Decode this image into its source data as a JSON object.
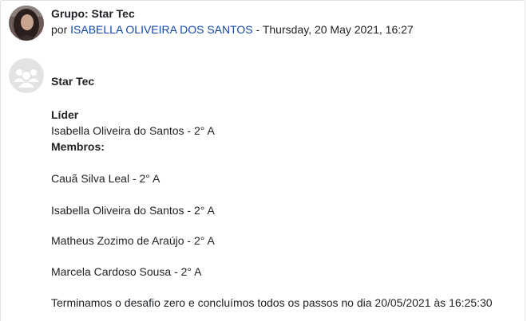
{
  "post": {
    "subject": "Grupo: Star Tec",
    "by_prefix": "por",
    "author": "ISABELLA OLIVEIRA DOS SANTOS",
    "date_sep": " - ",
    "date": "Thursday, 20 May 2021, 16:27",
    "group_title": "Star Tec",
    "leader_heading": "Líder",
    "leader": "Isabella Oliveira do Santos - 2° A",
    "members_heading": "Membros:",
    "members": [
      "Cauã Silva Leal  - 2° A",
      "Isabella Oliveira do Santos - 2° A",
      "Matheus Zozimo de Araújo - 2° A",
      "Marcela Cardoso Sousa - 2° A"
    ],
    "closing": "Terminamos o desafio zero e concluímos todos os passos no dia 20/05/2021 às 16:25:30"
  },
  "colors": {
    "link": "#0f47ad",
    "text": "#1d2125",
    "border": "#dee2e6",
    "group_avatar_bg": "#e3e3e3"
  },
  "icons": {
    "author_avatar": "user-photo",
    "group_avatar": "group-icon"
  }
}
